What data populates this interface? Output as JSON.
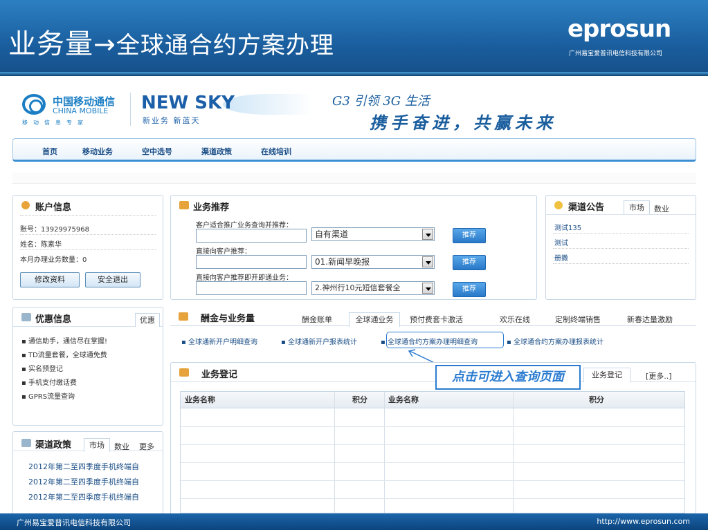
{
  "slide": {
    "title_main": "业务量",
    "title_arrow": "→",
    "title_sub": "全球通合约方案办理",
    "logo": "eprosun",
    "logo_sub": "广州易宝爱普讯电信科技有限公司",
    "footer_left": "广州易宝爱普讯电信科技有限公司",
    "footer_right": "http://www.eprosun.com"
  },
  "header": {
    "cm_cn": "中国移动通信",
    "cm_en": "CHINA MOBILE",
    "cm_tag": "移动信息专家",
    "newsky": "NEW SKY",
    "newsky_sub": "新业务  新蓝天",
    "slogan1": "G3 引领 3G 生活",
    "slogan2": "携手奋进，共赢未来"
  },
  "nav": {
    "items": [
      "首页",
      "移动业务",
      "空中选号",
      "渠道政策",
      "在线培训"
    ]
  },
  "account": {
    "title": "账户信息",
    "account_line": "账号：13929975968",
    "name_line": "姓名：陈素华",
    "count_line": "本月办理业务数量：0",
    "edit_btn": "修改资料",
    "logout_btn": "安全退出"
  },
  "recommend": {
    "title": "业务推荐",
    "label1": "客户适合推广业务查询并推荐：",
    "select1": "自有渠道",
    "label2": "直接向客户推荐：",
    "select2": "01.新闻早晚报",
    "label3": "直接向客户推荐即开即通业务：",
    "select3": "2.神州行10元短信套餐全",
    "btn": "推荐"
  },
  "notice": {
    "title": "渠道公告",
    "tab1": "市场",
    "tab2": "数业",
    "items": [
      "测试135",
      "测试",
      "册撒"
    ]
  },
  "promo": {
    "title": "优惠信息",
    "tab": "优惠",
    "items": [
      "通信助手，通信尽在掌握!",
      "TD流量套餐，全球通免费",
      "实名预登记",
      "手机支付缴话费",
      "GPRS流量查询"
    ]
  },
  "channel": {
    "title": "渠道政策",
    "tab1": "市场",
    "tab2": "数业",
    "tab3": "更多",
    "items": [
      "2012年第二至四季度手机终端自",
      "2012年第二至四季度手机终端自",
      "2012年第二至四季度手机终端自"
    ]
  },
  "reward": {
    "title": "酬金与业务量",
    "tabs": [
      "酬金账单",
      "全球通业务",
      "预付费套卡激活",
      "欢乐在线",
      "定制终端销售",
      "新春达量激励"
    ],
    "links": [
      "全球通新开户明细查询",
      "全球通新开户报表统计",
      "全球通合约方案办理明细查询",
      "全球通合约方案办理报表统计"
    ]
  },
  "callout": {
    "text": "点击可进入查询页面"
  },
  "register": {
    "title": "业务登记",
    "tab1": "业务登记",
    "tab2": "[更多..]",
    "col1": "业务名称",
    "col2": "积分",
    "col3": "业务名称",
    "col4": "积分"
  },
  "colors": {
    "brand_blue": "#1a5e9e",
    "accent_blue": "#2a7bd0"
  }
}
